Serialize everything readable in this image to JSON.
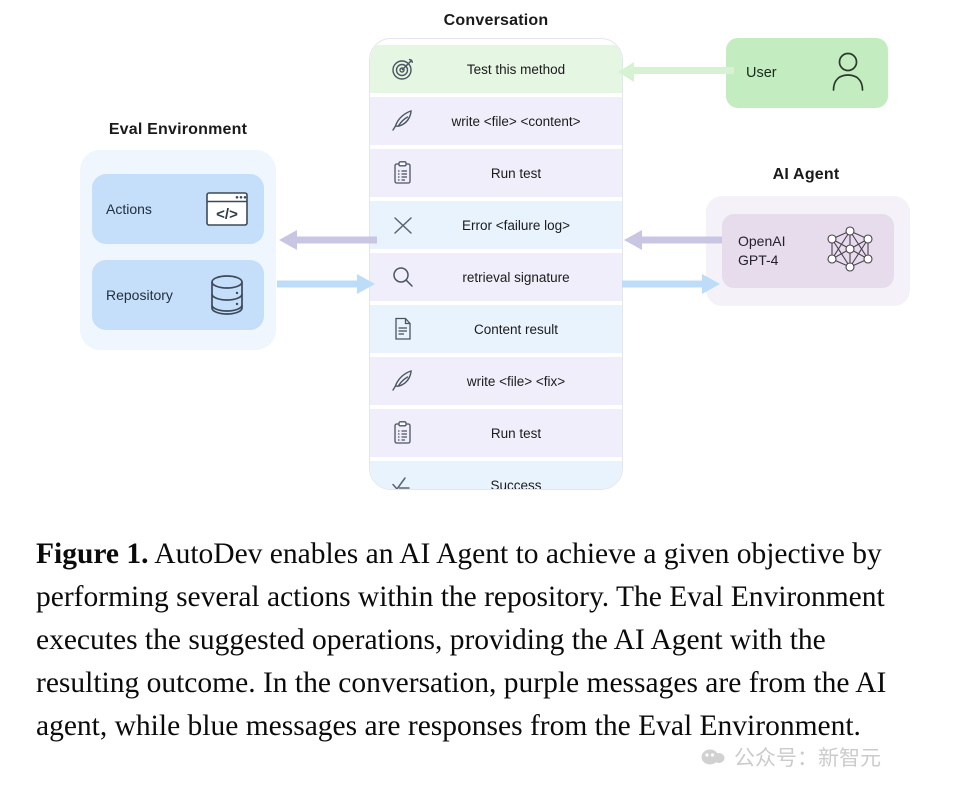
{
  "eval_environment": {
    "title": "Eval Environment",
    "cards": [
      {
        "label": "Actions",
        "icon": "code-window-icon"
      },
      {
        "label": "Repository",
        "icon": "database-icon"
      }
    ]
  },
  "conversation": {
    "title": "Conversation",
    "messages": [
      {
        "icon": "target-icon",
        "text": "Test this method",
        "role": "user"
      },
      {
        "icon": "quill-icon",
        "text": "write <file> <content>",
        "role": "agent"
      },
      {
        "icon": "clipboard-icon",
        "text": "Run test",
        "role": "agent"
      },
      {
        "icon": "x-icon",
        "text": "Error <failure log>",
        "role": "env"
      },
      {
        "icon": "search-icon",
        "text": "retrieval signature",
        "role": "agent"
      },
      {
        "icon": "document-icon",
        "text": "Content result",
        "role": "env"
      },
      {
        "icon": "quill-icon",
        "text": "write <file> <fix>",
        "role": "agent"
      },
      {
        "icon": "clipboard-icon",
        "text": "Run test",
        "role": "agent"
      },
      {
        "icon": "checklist-icon",
        "text": "Success",
        "role": "env"
      }
    ]
  },
  "user": {
    "label": "User",
    "icon": "person-icon"
  },
  "ai_agent": {
    "title": "AI Agent",
    "model_line1": "OpenAI",
    "model_line2": "GPT-4",
    "icon": "neural-network-icon"
  },
  "arrows": {
    "user_to_conversation": "left",
    "conversation_to_eval": "left",
    "eval_to_conversation": "right",
    "agent_to_conversation": "left",
    "conversation_to_agent": "right"
  },
  "colors": {
    "user_green": "#c3ecc0",
    "user_msg_green": "#e5f6e3",
    "agent_purple": "#f0eefb",
    "env_blue": "#e9f3fd",
    "eval_card_blue": "#c5defa",
    "eval_panel_blue": "#eff6fe",
    "agent_card_purple": "#e7dcec",
    "agent_panel_purple": "#f4f1f9",
    "arrow_purple": "#c9c6e4",
    "arrow_blue": "#bcdcf7",
    "arrow_green": "#d4f0d0"
  },
  "caption": {
    "label": "Figure 1.",
    "text": " AutoDev enables an AI Agent to achieve a given objective by performing several actions within the repository. The Eval Environment executes the suggested operations, providing the AI Agent with the resulting outcome. In the conversation, purple messages are from the AI agent, while blue messages are responses from the Eval Environment."
  },
  "watermark": {
    "text": "公众号：新智元"
  }
}
